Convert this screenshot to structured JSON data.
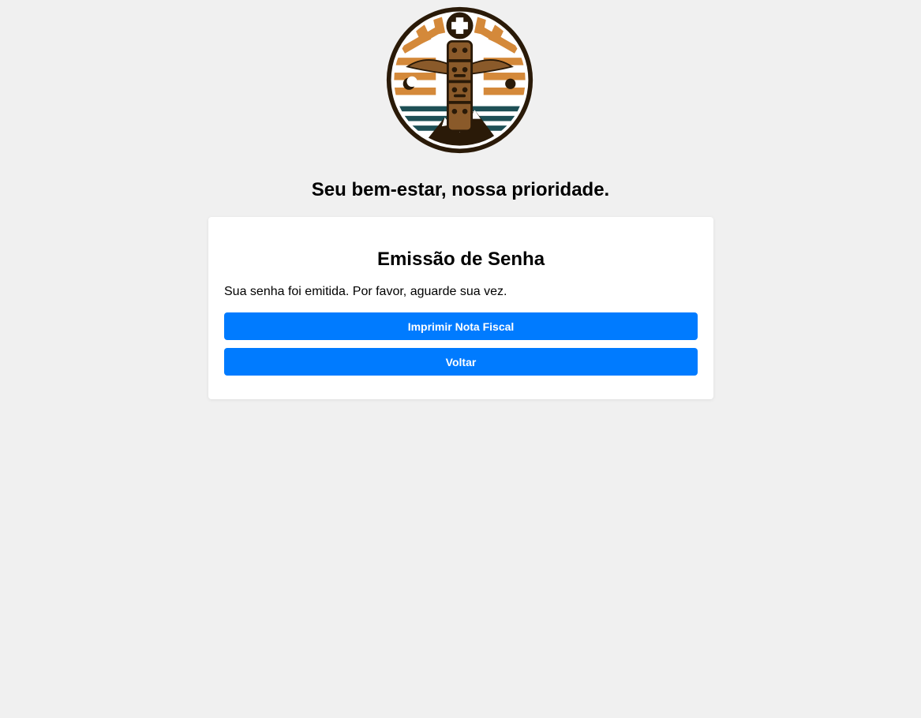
{
  "header": {
    "logo_icon": "totem-medical-cross-logo",
    "tagline": "Seu bem-estar, nossa prioridade."
  },
  "card": {
    "title": "Emissão de Senha",
    "message": "Sua senha foi emitida. Por favor, aguarde sua vez.",
    "print_button_label": "Imprimir Nota Fiscal",
    "back_button_label": "Voltar"
  },
  "colors": {
    "background": "#f0f0f0",
    "card_background": "#ffffff",
    "button_primary": "#007bff",
    "button_text": "#ffffff",
    "logo_orange": "#d4893a",
    "logo_dark": "#2a1a08",
    "logo_teal": "#1d4f55"
  }
}
